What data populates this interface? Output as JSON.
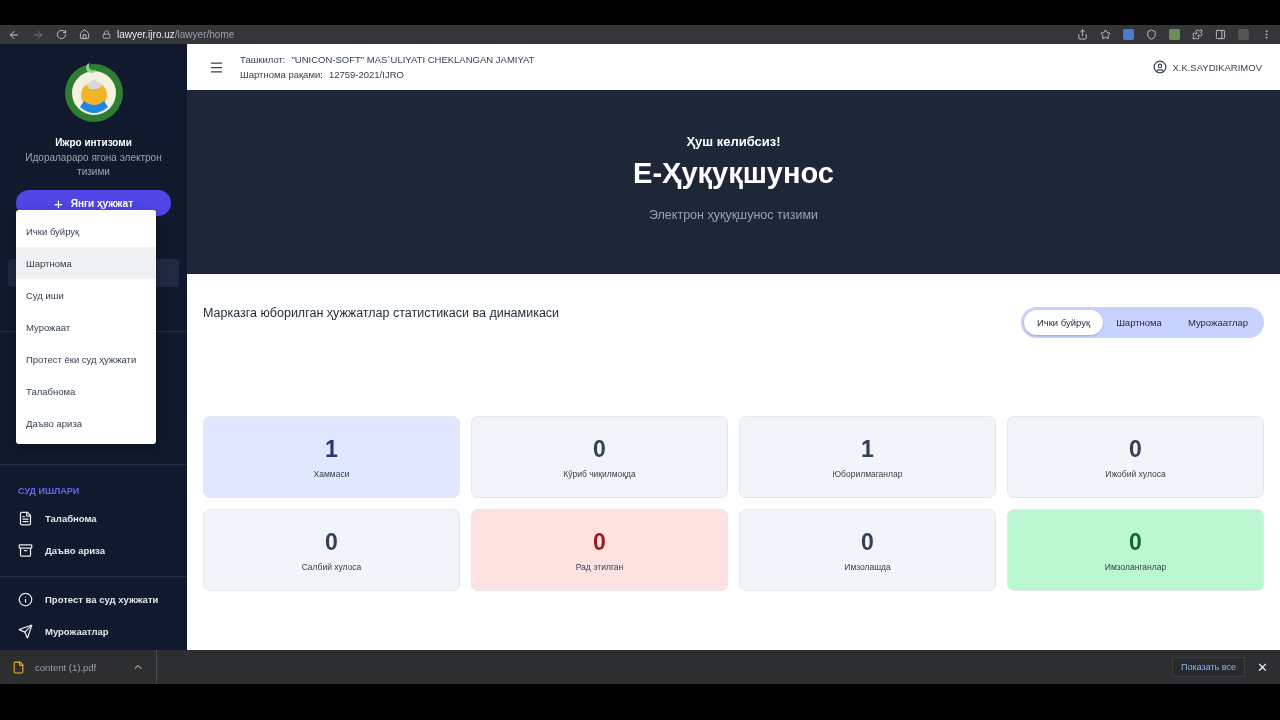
{
  "browser": {
    "url": {
      "host": "lawyer.ijro.uz",
      "path": "/lawyer/home"
    }
  },
  "sidebar": {
    "title": "Ижро интизоми",
    "subtitle": "Идоралараро ягона электрон тизими",
    "new_button": {
      "icon": "+",
      "label": "Янги ҳужжат"
    },
    "sections": [
      {
        "heading": "СУД ИШЛАРИ",
        "items": [
          {
            "label": "Талабнома"
          },
          {
            "label": "Даъво ариза"
          }
        ]
      },
      {
        "items": [
          {
            "label": "Протест ва суд хужжати"
          },
          {
            "label": "Мурожаатлар"
          }
        ]
      }
    ]
  },
  "new_menu": [
    {
      "label": "Ички буйруқ",
      "hovered": false
    },
    {
      "label": "Шартнома",
      "hovered": true
    },
    {
      "label": "Суд иши",
      "hovered": false
    },
    {
      "label": "Мурожаат",
      "hovered": false
    },
    {
      "label": "Протест ёки суд ҳужжати",
      "hovered": false
    },
    {
      "label": "Талабнома",
      "hovered": false
    },
    {
      "label": "Даъво ариза",
      "hovered": false
    }
  ],
  "header": {
    "organization_label": "Ташкилот:",
    "organization": "\"UNICON-SOFT\" MAS`ULIYATI CHEKLANGAN JAMIYAT",
    "contract_label": "Шартнома рақами:",
    "contract": "12759-2021/IJRO",
    "user": "X.K.SAYDIKARIMOV"
  },
  "hero": {
    "greeting": "Ҳуш келибсиз!",
    "title": "Е-Ҳуқуқшунос",
    "subtitle": "Электрон ҳуқуқшунос тизими"
  },
  "stats": {
    "title": "Марказга юборилган ҳужжатлар статистикаси ва динамикаси",
    "tabs": [
      {
        "label": "Ички буйруқ",
        "selected": true
      },
      {
        "label": "Шартнома",
        "selected": false
      },
      {
        "label": "Мурожаатлар",
        "selected": false
      }
    ],
    "cards": [
      {
        "value": "1",
        "label": "Хаммаси",
        "kind": "total"
      },
      {
        "value": "0",
        "label": "Кўриб чиқилмоқда",
        "kind": "neutral"
      },
      {
        "value": "1",
        "label": "Юборилмаганлар",
        "kind": "neutral"
      },
      {
        "value": "0",
        "label": "Ижобий хулоса",
        "kind": "neutral"
      },
      {
        "value": "0",
        "label": "Салбий хулоса",
        "kind": "neutral"
      },
      {
        "value": "0",
        "label": "Рад этилган",
        "kind": "rejected"
      },
      {
        "value": "0",
        "label": "Имзолашда",
        "kind": "neutral"
      },
      {
        "value": "0",
        "label": "Имзоланганлар",
        "kind": "signed"
      }
    ]
  },
  "download_bar": {
    "file": "content (1).pdf",
    "show_all": "Показать все",
    "close": "✕"
  }
}
